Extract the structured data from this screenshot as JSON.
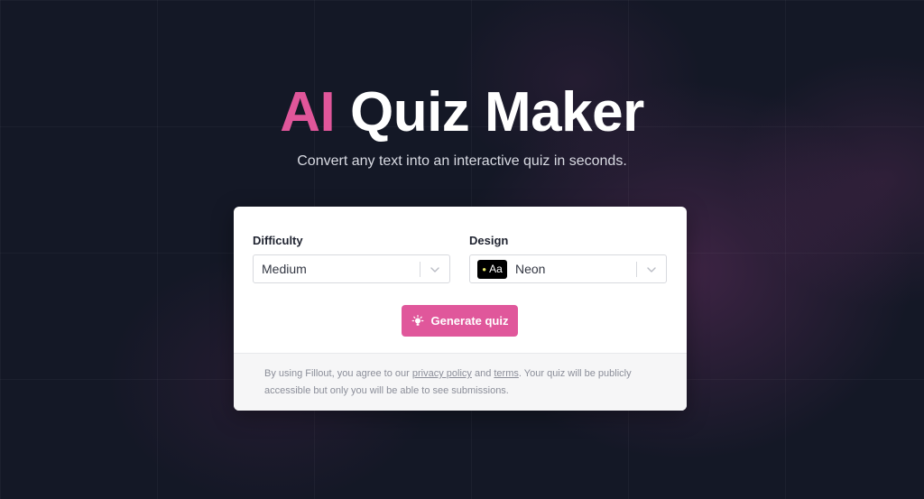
{
  "header": {
    "title_accent": "AI",
    "title_rest": "Quiz Maker",
    "subtitle": "Convert any text into an interactive quiz in seconds."
  },
  "form": {
    "difficulty": {
      "label": "Difficulty",
      "value": "Medium"
    },
    "design": {
      "label": "Design",
      "swatch_text": "Aa",
      "value": "Neon"
    },
    "generate_label": "Generate quiz"
  },
  "footer": {
    "text_1": "By using Fillout, you agree to our ",
    "privacy_link": "privacy policy",
    "text_2": " and ",
    "terms_link": "terms",
    "text_3": ". Your quiz will be publicly accessible but only you will be able to see submissions."
  },
  "colors": {
    "background": "#141826",
    "accent": "#e0569a",
    "button": "#e0579b"
  },
  "icons": {
    "chevron": "chevron-down-icon",
    "bulb": "lightbulb-icon"
  }
}
